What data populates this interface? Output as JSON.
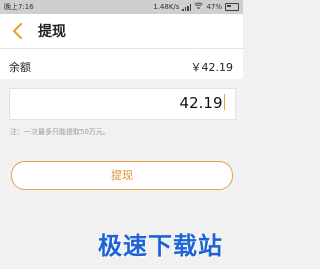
{
  "statusbar": {
    "time": "晚上7:16",
    "network_speed": "1.48K/s",
    "battery": "47%"
  },
  "header": {
    "title": "提现",
    "back_icon": "back-chevron-icon",
    "accent": "#e8a23a",
    "watermark": "jisu"
  },
  "balance": {
    "label": "余额",
    "value": "￥42.19"
  },
  "amount": {
    "value": "42.19"
  },
  "note": "注：一次最多只能提取50万元。",
  "withdraw_button": {
    "label": "提现",
    "color": "#d8922f"
  },
  "watermark": {
    "text": "极速下载站",
    "color": "#1d62d6"
  }
}
